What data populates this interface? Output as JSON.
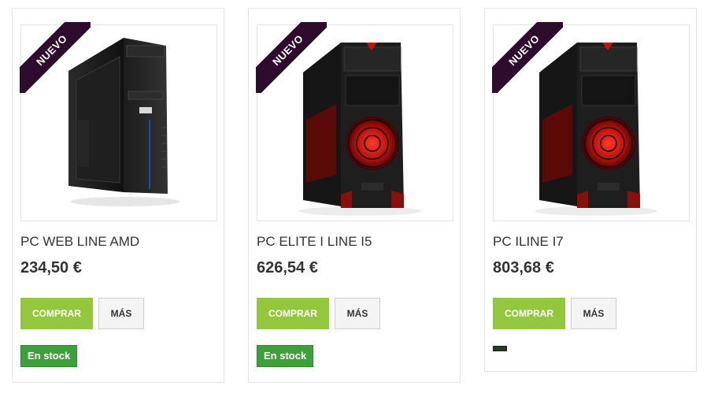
{
  "products": [
    {
      "badge": "NUEVO",
      "name": "PC WEB LINE AMD",
      "price": "234,50 €",
      "buy_label": "COMPRAR",
      "more_label": "MÁS",
      "stock": "En stock"
    },
    {
      "badge": "NUEVO",
      "name": "PC ELITE I LINE I5",
      "price": "626,54 €",
      "buy_label": "COMPRAR",
      "more_label": "MÁS",
      "stock": "En stock"
    },
    {
      "badge": "NUEVO",
      "name": "PC ILINE I7",
      "price": "803,68 €",
      "buy_label": "COMPRAR",
      "more_label": "MÁS",
      "stock": ""
    }
  ],
  "colors": {
    "buy_button": "#93c83e",
    "stock_badge": "#3f9f3a",
    "new_ribbon": "#2e0c2d"
  }
}
